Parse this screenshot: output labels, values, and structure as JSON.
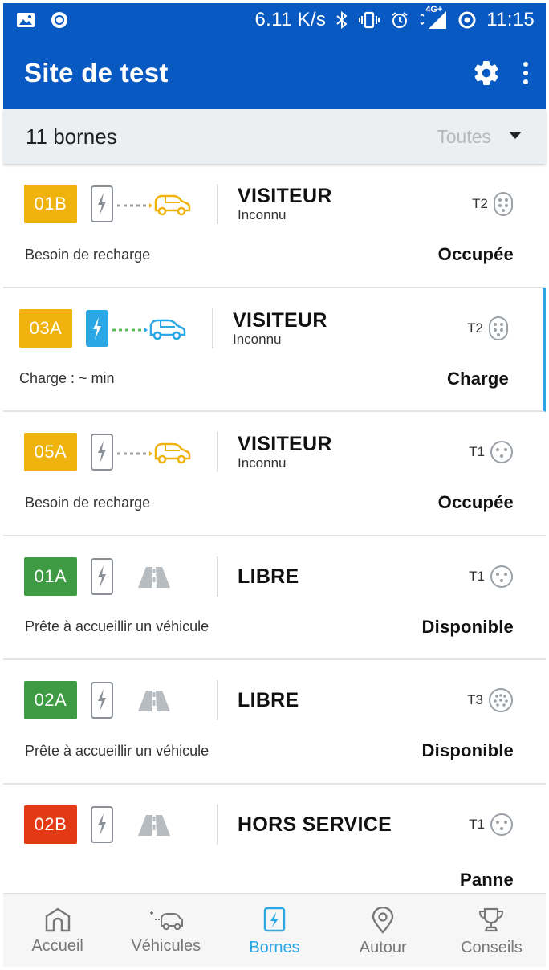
{
  "status_bar": {
    "speed": "6.11 K/s",
    "network": "4G+",
    "time": "11:15"
  },
  "app_bar": {
    "title": "Site de test",
    "settings_icon": "gear-icon",
    "menu_icon": "overflow-menu-icon"
  },
  "filter_bar": {
    "count": "11 bornes",
    "filter_value": "Toutes"
  },
  "colors": {
    "primary": "#0959c2",
    "accent": "#2aa7e4",
    "occupied": "#f0b20c",
    "free": "#3f9b43",
    "out_of_service": "#e33915"
  },
  "stations": [
    {
      "id": "01B",
      "badge_color": "#f0b20c",
      "plug": "outline",
      "vehicle": "car-yellow",
      "title": "VISITEUR",
      "subtitle": "Inconnu",
      "connector": "T2",
      "detail": "Besoin de recharge",
      "state": "Occupée"
    },
    {
      "id": "03A",
      "badge_color": "#f0b20c",
      "plug": "blue",
      "vehicle": "car-blue",
      "title": "VISITEUR",
      "subtitle": "Inconnu",
      "connector": "T2",
      "detail": "Charge : ~ min",
      "state": "Charge"
    },
    {
      "id": "05A",
      "badge_color": "#f0b20c",
      "plug": "outline",
      "vehicle": "car-yellow",
      "title": "VISITEUR",
      "subtitle": "Inconnu",
      "connector": "T1",
      "detail": "Besoin de recharge",
      "state": "Occupée"
    },
    {
      "id": "01A",
      "badge_color": "#3f9b43",
      "plug": "outline",
      "vehicle": "road",
      "title": "LIBRE",
      "subtitle": "",
      "connector": "T1",
      "detail": "Prête à accueillir un véhicule",
      "state": "Disponible"
    },
    {
      "id": "02A",
      "badge_color": "#3f9b43",
      "plug": "outline",
      "vehicle": "road",
      "title": "LIBRE",
      "subtitle": "",
      "connector": "T3",
      "detail": "Prête à accueillir un véhicule",
      "state": "Disponible"
    },
    {
      "id": "02B",
      "badge_color": "#e33915",
      "plug": "outline",
      "vehicle": "road",
      "title": "HORS SERVICE",
      "subtitle": "",
      "connector": "T1",
      "detail": "",
      "state": "Panne"
    }
  ],
  "bottom_nav": [
    {
      "label": "Accueil",
      "icon": "home-icon",
      "active": false
    },
    {
      "label": "Véhicules",
      "icon": "car-plug-icon",
      "active": false
    },
    {
      "label": "Bornes",
      "icon": "charging-station-icon",
      "active": true
    },
    {
      "label": "Autour",
      "icon": "map-pin-icon",
      "active": false
    },
    {
      "label": "Conseils",
      "icon": "trophy-icon",
      "active": false
    }
  ]
}
